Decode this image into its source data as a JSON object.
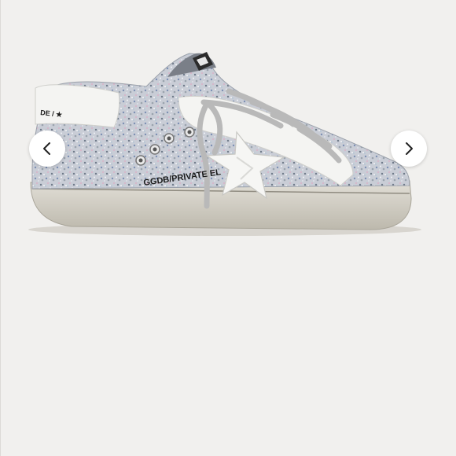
{
  "viewer": {
    "prev_icon": "chevron-left-icon",
    "next_icon": "chevron-right-icon"
  },
  "product_image": {
    "side_print": "GGDB/PRIVATE EL",
    "heel_print": "DE / ★",
    "colors": {
      "glitter_base": "#c9cdd6",
      "leather": "#f4f4f2",
      "sole": "#d9d6cc",
      "laces": "#b9b9b9",
      "print": "#1a1a1a"
    }
  }
}
